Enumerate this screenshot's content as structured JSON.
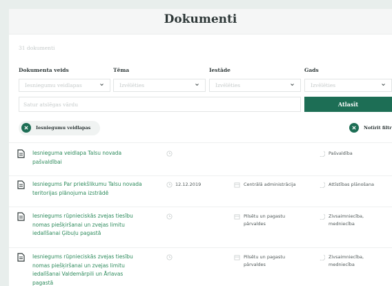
{
  "page": {
    "title": "Dokumenti",
    "count": "31 dokumenti"
  },
  "filters": [
    {
      "label": "Dokumenta veids",
      "value": "Iesniegumu veidlapas"
    },
    {
      "label": "Tēma",
      "value": "Izvēlēties"
    },
    {
      "label": "Iestāde",
      "value": "Izvēlēties"
    },
    {
      "label": "Gads",
      "value": "Izvēlēties"
    }
  ],
  "search": {
    "placeholder": "Satur atslēgas vārdu",
    "button": "Atlasīt"
  },
  "active_filter": {
    "label": "Iesniegumu veidlapas"
  },
  "clear_filters": {
    "label": "Notīrīt filtru"
  },
  "documents": [
    {
      "title": "Iesnieguma veidlapa Talsu novada pašvaldībai",
      "date": "",
      "institution": "",
      "topic": "Pašvaldība"
    },
    {
      "title": "Iesniegums Par priekšlikumu Talsu novada teritorijas plānojuma izstrādē",
      "date": "12.12.2019",
      "institution": "Centrālā administrācija",
      "topic": "Attīstības plānošana"
    },
    {
      "title": "Iesniegums rūpnieciskās zvejas tiesību nomas piešķiršanai un zvejas limitu iedalīšanai Ģibuļu pagastā",
      "date": "",
      "institution": "Pilsētu un pagastu pārvaldes",
      "topic": "Zivsaimniecība, medniecība"
    },
    {
      "title": "Iesniegums rūpnieciskās zvejas tiesību nomas piešķiršanai un zvejas limitu iedalīšanai Valdemārpili un Ārlavas pagastā",
      "date": "",
      "institution": "Pilsētu un pagastu pārvaldes",
      "topic": "Zivsaimniecība, medniecība"
    }
  ],
  "colors": {
    "accent": "#1d6e55",
    "link": "#2c8a5b"
  }
}
